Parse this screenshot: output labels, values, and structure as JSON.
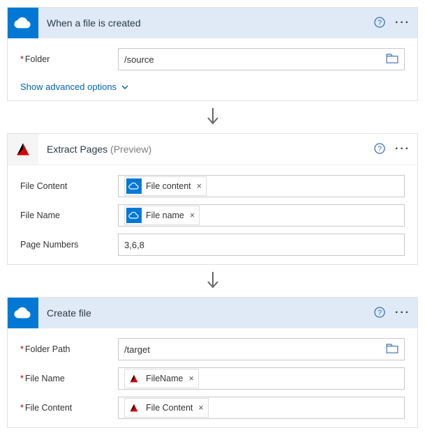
{
  "step1": {
    "title": "When a file is created",
    "folder_label": "Folder",
    "folder_value": "/source",
    "advanced_link": "Show advanced options"
  },
  "step2": {
    "title": "Extract Pages",
    "preview_suffix": "(Preview)",
    "file_content_label": "File Content",
    "file_content_token": "File content",
    "file_name_label": "File Name",
    "file_name_token": "File name",
    "page_numbers_label": "Page Numbers",
    "page_numbers_value": "3,6,8"
  },
  "step3": {
    "title": "Create file",
    "folder_path_label": "Folder Path",
    "folder_path_value": "/target",
    "file_name_label": "File Name",
    "file_name_token": "FileName",
    "file_content_label": "File Content",
    "file_content_token": "File Content"
  },
  "icons": {
    "token_close": "×"
  }
}
